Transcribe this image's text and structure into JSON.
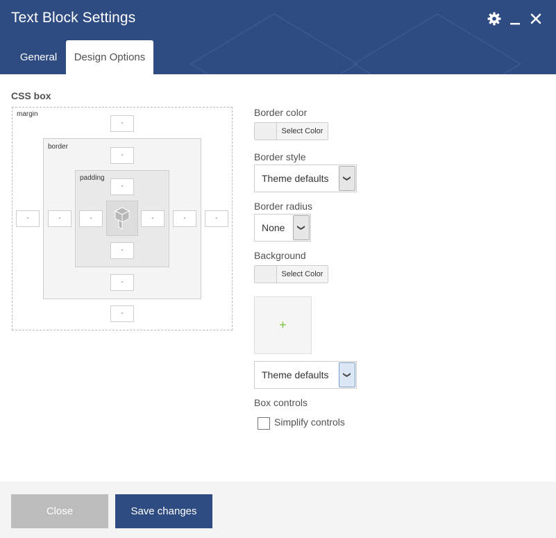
{
  "window": {
    "title": "Text Block Settings",
    "icons": [
      "gear-icon",
      "minimize-icon",
      "close-icon"
    ]
  },
  "tabs": [
    {
      "label": "General",
      "active": false
    },
    {
      "label": "Design Options",
      "active": true
    }
  ],
  "css_box": {
    "title": "CSS box",
    "margin_label": "margin",
    "border_label": "border",
    "padding_label": "padding",
    "margin": {
      "top": "-",
      "right": "-",
      "bottom": "-",
      "left": "-"
    },
    "border": {
      "top": "-",
      "right": "-",
      "bottom": "-",
      "left": "-"
    },
    "padding": {
      "top": "-",
      "right": "-",
      "bottom": "-",
      "left": "-"
    }
  },
  "options": {
    "border_color": {
      "label": "Border color",
      "button": "Select Color"
    },
    "border_style": {
      "label": "Border style",
      "value": "Theme defaults"
    },
    "border_radius": {
      "label": "Border radius",
      "value": "None"
    },
    "background": {
      "label": "Background",
      "button": "Select Color",
      "add_image": "+",
      "style_value": "Theme defaults"
    },
    "box_controls": {
      "label": "Box controls",
      "checkbox_label": "Simplify controls",
      "checked": false
    }
  },
  "footer": {
    "close_label": "Close",
    "save_label": "Save changes"
  },
  "colors": {
    "header": "#2e4c82",
    "save_button": "#2e4c82",
    "close_button": "#bcbcbc",
    "add_plus": "#7cc142"
  }
}
